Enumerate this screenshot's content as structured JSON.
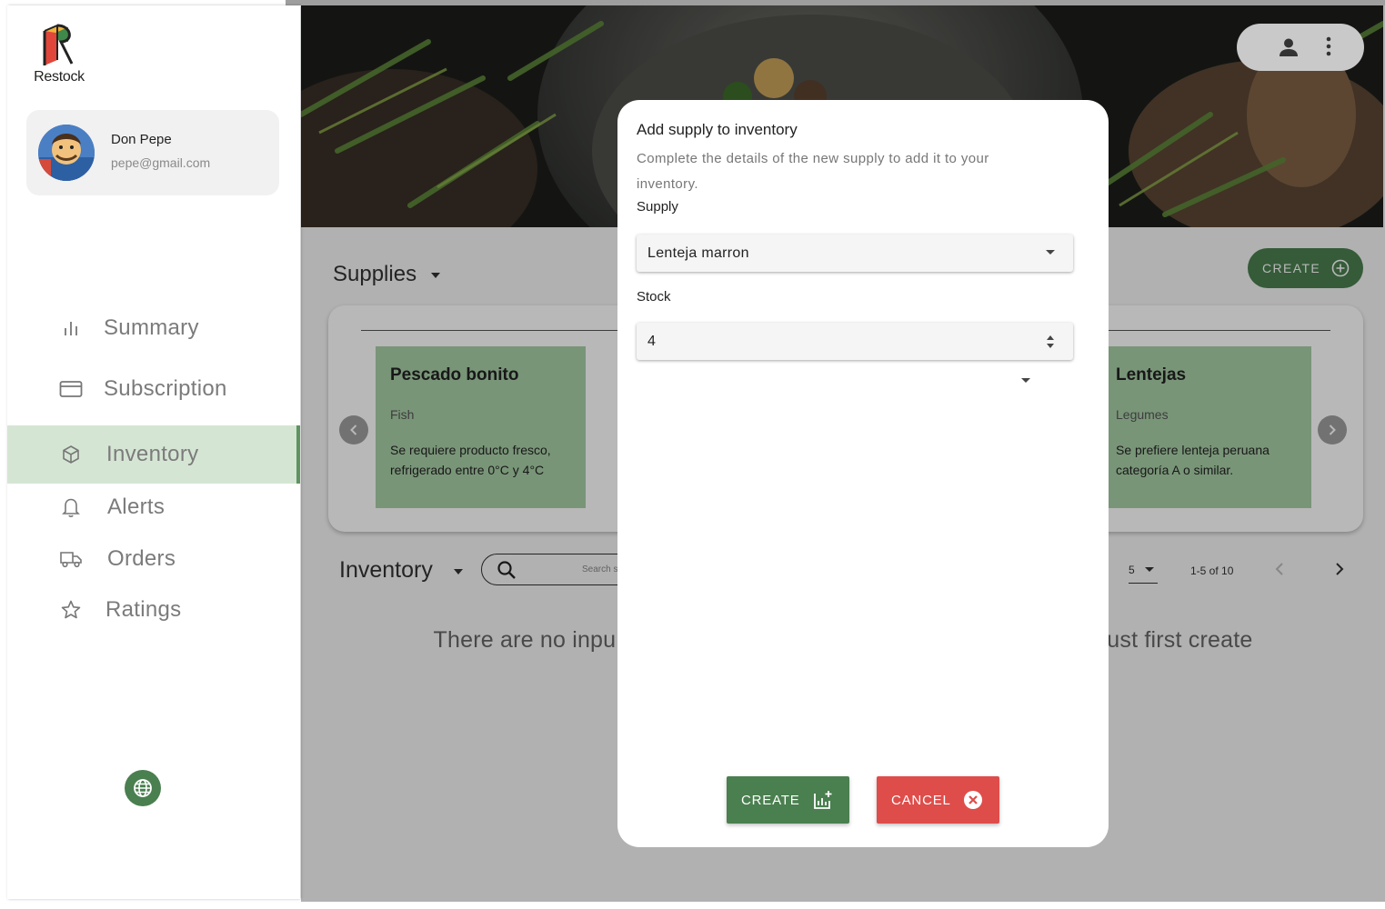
{
  "app": {
    "name": "Restock"
  },
  "profile": {
    "name": "Don Pepe",
    "email": "pepe@gmail.com"
  },
  "nav": {
    "items": [
      {
        "label": "Summary",
        "icon": "bar-chart-icon"
      },
      {
        "label": "Subscription",
        "icon": "credit-card-icon"
      },
      {
        "label": "Inventory",
        "icon": "cube-icon",
        "active": true
      },
      {
        "label": "Alerts",
        "icon": "bell-icon"
      },
      {
        "label": "Orders",
        "icon": "truck-icon"
      },
      {
        "label": "Ratings",
        "icon": "star-icon"
      }
    ]
  },
  "supplies": {
    "title": "Supplies",
    "create_label": "CREATE",
    "cards": [
      {
        "title": "Pescado bonito",
        "category": "Fish",
        "description": "Se requiere producto fresco, refrigerado entre 0°C y 4°C"
      },
      {
        "title": "Lentejas",
        "category": "Legumes",
        "description": "Se prefiere lenteja peruana categoría A o similar."
      }
    ]
  },
  "inventory": {
    "title": "Inventory",
    "search_placeholder": "Search s",
    "page_size": "5",
    "range": "1-5 of 10",
    "empty_left": "There are no inpu",
    "empty_right": "ust first create"
  },
  "dialog": {
    "title": "Add supply to inventory",
    "subtitle": "Complete the details of the new supply to add it to your inventory.",
    "supply_label": "Supply",
    "supply_value": "Lenteja marron",
    "stock_label": "Stock",
    "stock_value": "4",
    "create_label": "CREATE",
    "cancel_label": "CANCEL"
  },
  "colors": {
    "primary": "#4a7f4f",
    "danger": "#de4d4a",
    "card": "#a8cfa7",
    "nav_active": "#d5e5d4"
  }
}
